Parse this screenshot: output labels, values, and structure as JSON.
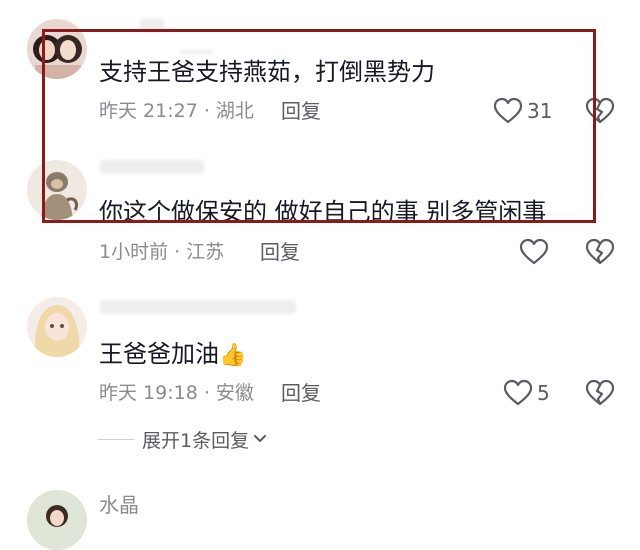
{
  "comments": [
    {
      "text": "支持王爸支持燕茹，打倒黑势力",
      "meta": "昨天 21:27 · 湖北",
      "reply_label": "回复",
      "likes": "31"
    },
    {
      "text": "你这个做保安的  做好自己的事  别多管闲事",
      "meta": "1小时前 · 江苏",
      "reply_label": "回复",
      "likes": ""
    },
    {
      "text": "王爸爸加油",
      "emoji": "👍",
      "meta": "昨天 19:18 · 安徽",
      "reply_label": "回复",
      "likes": "5",
      "expand_label": "展开1条回复"
    },
    {
      "username": "水晶"
    }
  ],
  "colors": {
    "highlight_border": "#8b1a1a",
    "meta_text": "#8a8b91",
    "body_text": "#161823",
    "icon_stroke": "#5b5c63"
  },
  "icons": {
    "like": "heart-outline-icon",
    "dislike": "broken-heart-icon",
    "expand": "chevron-down-icon"
  }
}
